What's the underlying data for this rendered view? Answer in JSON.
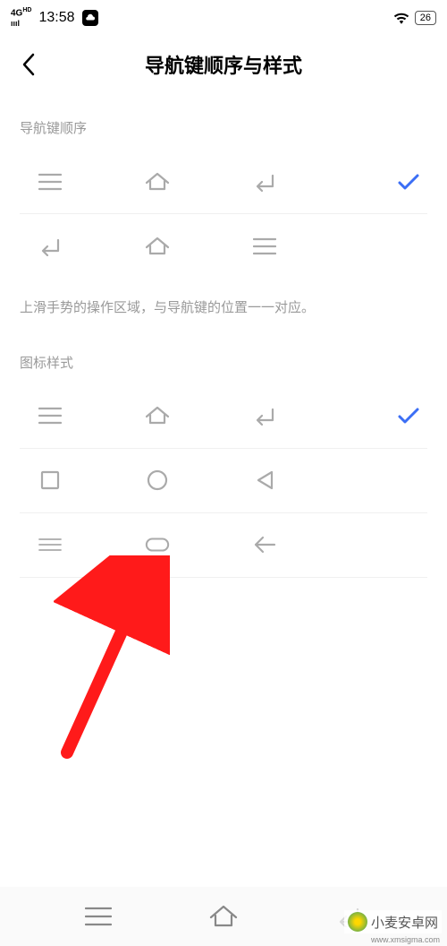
{
  "status": {
    "network": "4G HD",
    "time": "13:58",
    "battery": "26"
  },
  "header": {
    "title": "导航键顺序与样式"
  },
  "sections": {
    "order_label": "导航键顺序",
    "hint": "上滑手势的操作区域，与导航键的位置一一对应。",
    "style_label": "图标样式"
  },
  "watermark": {
    "name": "小麦安卓网",
    "url": "www.xmsigma.com"
  },
  "colors": {
    "accent": "#3b6ef5",
    "muted": "#aaa",
    "arrow": "#ff1a1a"
  }
}
